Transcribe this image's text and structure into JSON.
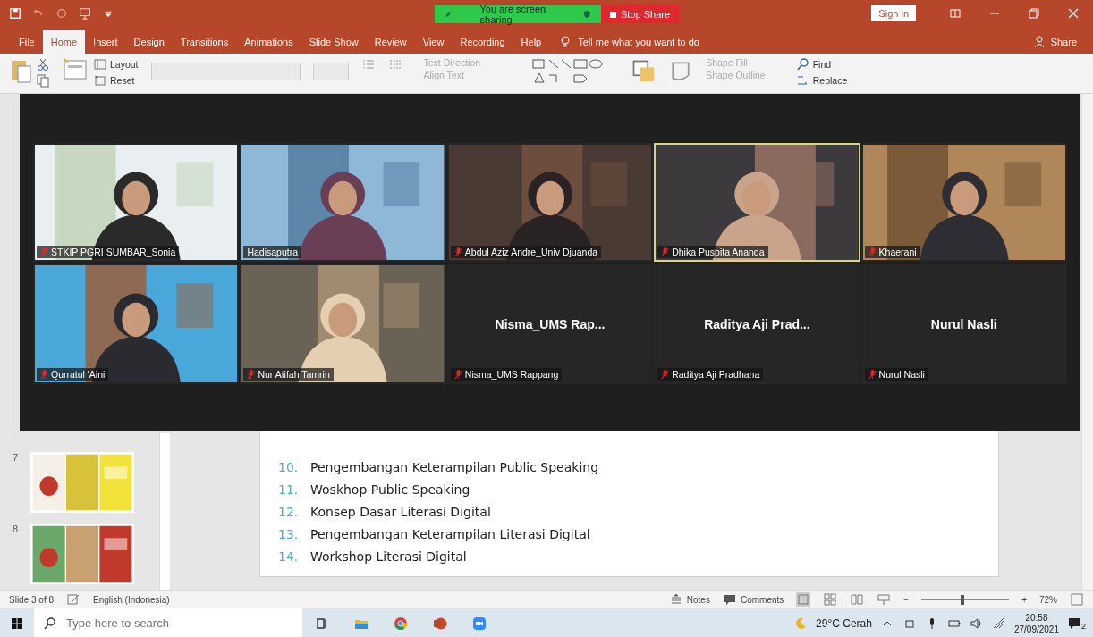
{
  "title_bar": {
    "sharing_banner": "You are screen sharing",
    "stop_share": "Stop Share",
    "sign_in": "Sign in"
  },
  "tabs": [
    {
      "label": "File",
      "selected": false
    },
    {
      "label": "Home",
      "selected": true
    },
    {
      "label": "Insert",
      "selected": false
    },
    {
      "label": "Design",
      "selected": false
    },
    {
      "label": "Transitions",
      "selected": false
    },
    {
      "label": "Animations",
      "selected": false
    },
    {
      "label": "Slide Show",
      "selected": false
    },
    {
      "label": "Review",
      "selected": false
    },
    {
      "label": "View",
      "selected": false
    },
    {
      "label": "Recording",
      "selected": false
    },
    {
      "label": "Help",
      "selected": false
    }
  ],
  "tell_me": {
    "placeholder": "Tell me what you want to do"
  },
  "share": "Share",
  "ribbon": {
    "layout": "Layout",
    "reset": "Reset",
    "text_direction": "Text Direction",
    "align_text": "Align Text",
    "shape_fill": "Shape Fill",
    "shape_outline": "Shape Outline",
    "find": "Find",
    "replace": "Replace"
  },
  "thumbnails": [
    {
      "number": "7"
    },
    {
      "number": "8"
    }
  ],
  "slide": {
    "items": [
      {
        "number": "10.",
        "text": "Pengembangan Keterampilan Public Speaking"
      },
      {
        "number": "11.",
        "text": "Woskhop Public Speaking"
      },
      {
        "number": "12.",
        "text": "Konsep Dasar Literasi Digital"
      },
      {
        "number": "13.",
        "text": "Pengembangan Keterampilan Literasi Digital"
      },
      {
        "number": "14.",
        "text": "Workshop Literasi Digital"
      }
    ]
  },
  "participants": [
    {
      "kind": "video",
      "name": "STKIP PGRI SUMBAR_Sonia",
      "muted": true,
      "speaking": false
    },
    {
      "kind": "video",
      "name": "Hadisaputra",
      "muted": false,
      "speaking": false
    },
    {
      "kind": "video",
      "name": "Abdul Aziz Andre_Univ Djuanda",
      "muted": true,
      "speaking": false
    },
    {
      "kind": "video",
      "name": "Dhika Puspita Ananda",
      "muted": true,
      "speaking": true
    },
    {
      "kind": "video",
      "name": "Khaerani",
      "muted": true,
      "speaking": false
    },
    {
      "kind": "video",
      "name": "Qurratul 'Aini",
      "muted": true,
      "speaking": false
    },
    {
      "kind": "video",
      "name": "Nur Atifah Tamrin",
      "muted": true,
      "speaking": false
    },
    {
      "kind": "name",
      "display": "Nisma_UMS  Rap...",
      "name": "Nisma_UMS Rappang",
      "muted": true,
      "speaking": false
    },
    {
      "kind": "name",
      "display": "Raditya Aji Prad...",
      "name": "Raditya Aji Pradhana",
      "muted": true,
      "speaking": false
    },
    {
      "kind": "name",
      "display": "Nurul Nasli",
      "name": "Nurul Nasli",
      "muted": true,
      "speaking": false
    }
  ],
  "status_bar": {
    "slide": "Slide 3 of 8",
    "language": "English (Indonesia)",
    "notes": "Notes",
    "comments": "Comments",
    "zoom_out": "−",
    "zoom": {
      "level": 0.45
    },
    "zoom_in": "+",
    "zoom_reading": "72%"
  },
  "taskbar": {
    "search": {
      "placeholder": "Type here to search"
    },
    "weather": "29°C  Cerah",
    "time": "20:58",
    "date": "27/09/2021",
    "notifications": "2"
  }
}
